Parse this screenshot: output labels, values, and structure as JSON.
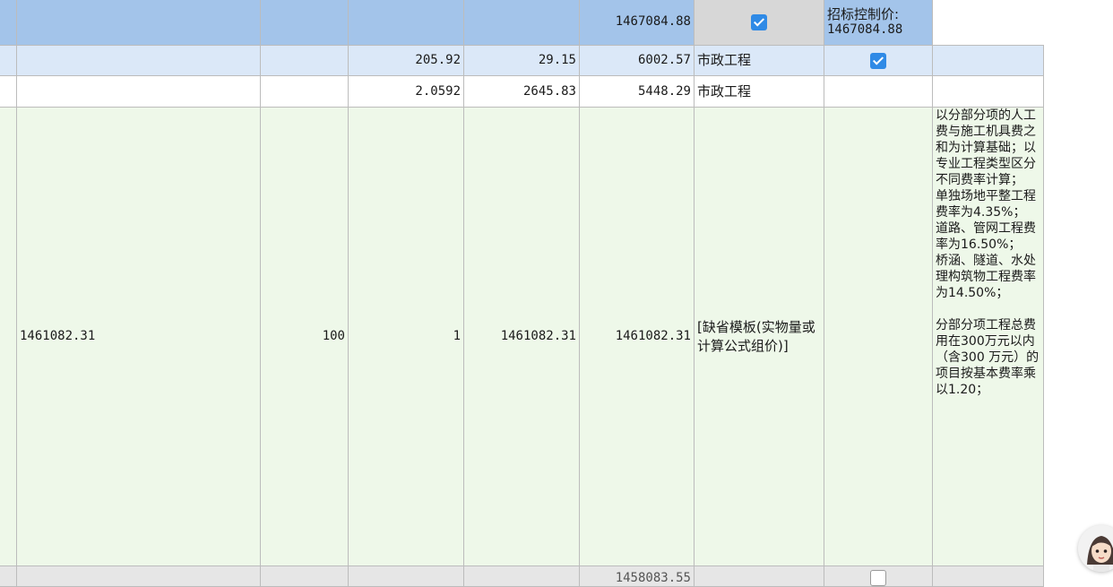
{
  "rows": [
    {
      "c5": "1467084.88",
      "c7_line1": "招标控制价:",
      "c7_line2": "1467084.88"
    },
    {
      "c2": "205.92",
      "c3": "29.15",
      "c4": "6002.57",
      "c5": "市政工程"
    },
    {
      "c2": "2.0592",
      "c3": "2645.83",
      "c4": "5448.29",
      "c5": "市政工程"
    },
    {
      "c0": "1461082.31",
      "c1": "100",
      "c2": "1",
      "c3": "1461082.31",
      "c4": "1461082.31",
      "c5": "[缺省模板(实物量或计算公式组价)]",
      "note": [
        "以分部分项的人工费与施工机具费之和为计算基础；以专业工程类型区分不同费率计算；",
        "单独场地平整工程费率为4.35%；",
        "道路、管网工程费率为16.50%；",
        "桥涵、隧道、水处理构筑物工程费率为14.50%；",
        "",
        "分部分项工程总费用在300万元以内（含300 万元）的项目按基本费率乘以1.20；"
      ]
    },
    {
      "c4": "1458083.55"
    }
  ],
  "icons": {
    "checked": "checkbox-checked-icon",
    "unchecked": "checkbox-empty-icon",
    "assistant": "assistant-avatar-icon"
  },
  "colors": {
    "selected_row": "#a3c4ea",
    "light_row": "#dbe8f8",
    "green_row": "#eef8e9",
    "checkbox": "#2f8ae6"
  }
}
